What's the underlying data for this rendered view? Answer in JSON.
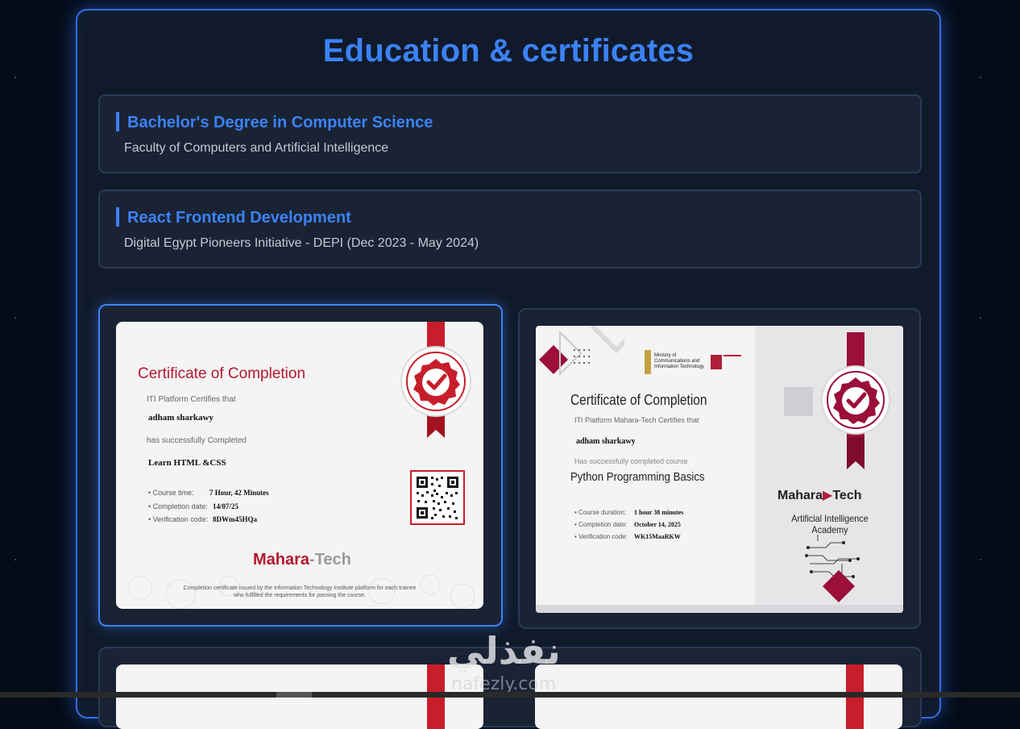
{
  "section": {
    "title": "Education & certificates"
  },
  "education": [
    {
      "title": "Bachelor's Degree in Computer Science",
      "subtitle": "Faculty of Computers and Artificial Intelligence"
    },
    {
      "title": "React Frontend Development",
      "subtitle": "Digital Egypt Pioneers Initiative - DEPI (Dec 2023 - May 2024)"
    }
  ],
  "certificates": [
    {
      "heading": "Certificate of Completion",
      "certifies": "ITI Platform Certifies that",
      "name": "adham sharkawy",
      "completed_text": "has successfully Completed",
      "course": "Learn HTML &CSS",
      "details": [
        {
          "label": "Course time:",
          "value": "7 Hour, 42 Minutes"
        },
        {
          "label": "Completion date:",
          "value": "14/07/25"
        },
        {
          "label": "Verification code:",
          "value": "8DWm45HQa"
        }
      ],
      "brand_a": "Mahara",
      "brand_b": "-Tech",
      "footer_line1": "Completion certificate issued by the Information Technology Institute platform for each trainee",
      "footer_line2": "who fulfilled the requirements for passing the course.",
      "accent": "#b5172e"
    },
    {
      "heading": "Certificate of Completion",
      "certifies": "ITI Platform Mahara-Tech Certifies that",
      "name": "adham sharkawy",
      "completed_text": "Has successfully completed course",
      "course": "Python Programming Basics",
      "details": [
        {
          "label": "Course duration:",
          "value": "1 hour 38 minutes"
        },
        {
          "label": "Completion date:",
          "value": "October 14, 2025"
        },
        {
          "label": "Verification code:",
          "value": "WK15MaaRKW"
        }
      ],
      "ministry": "Ministry of Communications and Information Technology",
      "brand_a": "Mahara",
      "brand_b": "Tech",
      "academy": "Artificial Intelligence Academy",
      "accent": "#9b0f3a"
    }
  ],
  "watermark": {
    "arabic": "نفذلي",
    "latin": "nafezly.com"
  }
}
